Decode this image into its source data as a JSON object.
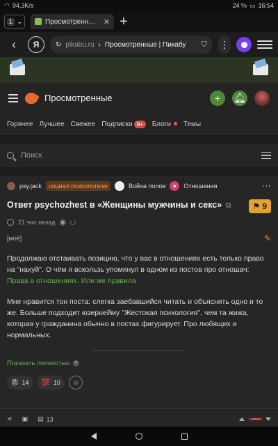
{
  "status": {
    "net": "94,3K/s",
    "battery": "24 %",
    "time": "16:54"
  },
  "browser": {
    "tab_count": "1",
    "tab_title": "Просмотренные | Пика",
    "domain": "pikabu.ru",
    "path": "Просмотренные | Пикабу",
    "ya_letter": "Я"
  },
  "pikabu": {
    "header_title": "Просмотренные",
    "nav": [
      "Горячее",
      "Лучшее",
      "Свежее",
      "Подписки",
      "Блоги",
      "Темы"
    ],
    "subs_badge": "9+",
    "search_placeholder": "Поиск"
  },
  "story": {
    "author": "psy.jack",
    "community": "социал психологизм",
    "tags": [
      "Война полов",
      "Отношения"
    ],
    "title": "Ответ psychozhest в «Женщины мужчины и секс»",
    "rating": "9",
    "time": "21 час назад",
    "edit_label": "[моё]",
    "para1_text": "Продолжаю отстаивать позицию, что у вас в отношениях есть только право на \"нахуй\". О чём я вскользь упомянул в одном из постов про отношач: ",
    "para1_link": "Права в отношениях. Или же правила",
    "para2": "Мне нравится тон поста: слегка заебавшийся читать и объяснять одно и то же. Больше подходит юзернейму \"Жестокая психология\", чем та жижа, которая у гражданина обычно в постах фигурирует. Про любящих и нормальных.",
    "show_full": "Показать полностью",
    "reactions": [
      {
        "emoji": "😡",
        "count": "14"
      },
      {
        "emoji": "💯",
        "count": "10"
      }
    ],
    "comments": "13",
    "vote_share": 0.3
  },
  "colors": {
    "accent_green": "#6aaf52",
    "rating_orange": "#e6a22c",
    "bg": "#1c1c1c"
  }
}
